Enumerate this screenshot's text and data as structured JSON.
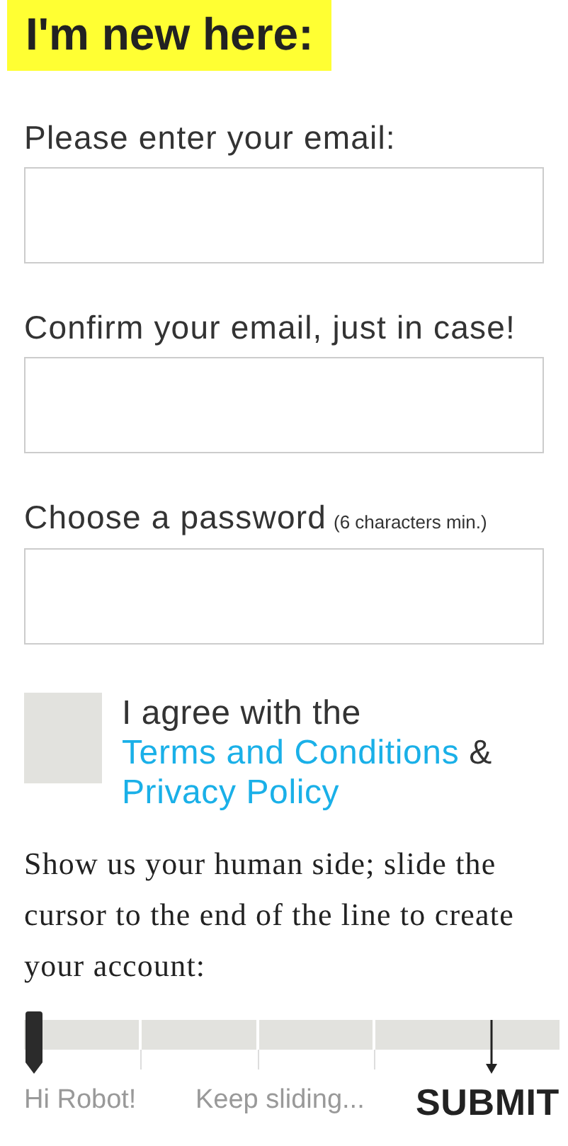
{
  "heading": "I'm new here:",
  "fields": [
    {
      "label": "Please enter your email:"
    },
    {
      "label": "Confirm your email, just in case!"
    },
    {
      "label": "Choose a password",
      "hint": "(6 characters min.)"
    }
  ],
  "agreement": {
    "checked": false,
    "parts": [
      {
        "kind": "text",
        "text": "I agree with the "
      },
      {
        "kind": "link",
        "text": "Terms and Conditions"
      },
      {
        "kind": "text",
        "text": " & "
      },
      {
        "kind": "link",
        "text": "Privacy Policy"
      }
    ]
  },
  "instructions": "Show us your human side; slide the cursor to the end of the line to create your account:",
  "slider": {
    "level": 0,
    "stops": [
      {
        "kind": "hint",
        "text": "Hi Robot!"
      },
      {
        "kind": "hint",
        "text": "Keep sliding..."
      },
      {
        "kind": "goal",
        "text": "SUBMIT"
      }
    ]
  }
}
